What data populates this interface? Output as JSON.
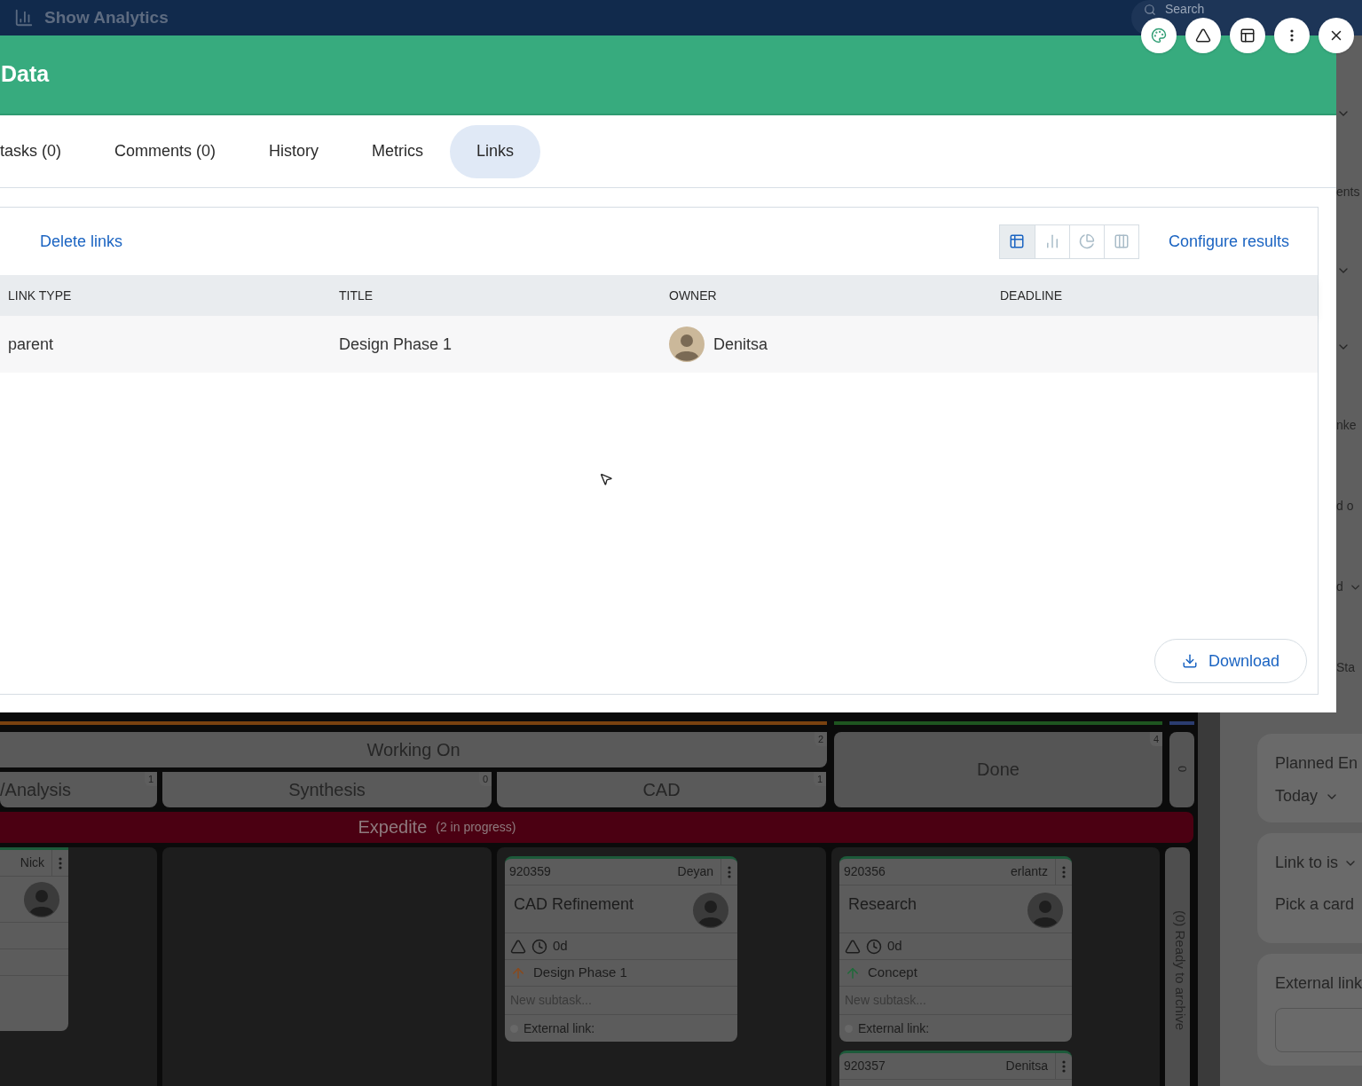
{
  "top_bar": {
    "title": "Show Analytics",
    "search": "Search"
  },
  "window_buttons": [
    {
      "kind": "palette"
    },
    {
      "kind": "warning"
    },
    {
      "kind": "layout"
    },
    {
      "kind": "more"
    },
    {
      "kind": "close"
    }
  ],
  "modal": {
    "title": "Data",
    "tabs": [
      {
        "label": "tasks (0)",
        "selected": false
      },
      {
        "label": "Comments (0)",
        "selected": false
      },
      {
        "label": "History",
        "selected": false
      },
      {
        "label": "Metrics",
        "selected": false
      },
      {
        "label": "Links",
        "selected": true
      }
    ],
    "delete_link": "Delete links",
    "views": [
      {
        "kind": "table",
        "selected": true
      },
      {
        "kind": "bar",
        "selected": false
      },
      {
        "kind": "pie",
        "selected": false
      },
      {
        "kind": "columns",
        "selected": false
      }
    ],
    "configure_link": "Configure results",
    "table": {
      "columns": [
        "LINK TYPE",
        "TITLE",
        "OWNER",
        "DEADLINE"
      ],
      "rows": [
        {
          "link_type": "parent",
          "title": "Design Phase 1",
          "owner": "Denitsa"
        }
      ]
    },
    "download_button": "Download"
  },
  "board": {
    "stages": [
      {
        "title": "Working On",
        "count": "2",
        "color": "#7a4210",
        "substages": [
          {
            "title": "/Analysis",
            "count": "1"
          },
          {
            "title": "Synthesis",
            "count": "0"
          },
          {
            "title": "CAD",
            "count": "1"
          }
        ]
      },
      {
        "title": "Done",
        "count": "4",
        "color": "#1e5520"
      }
    ],
    "archive": {
      "count": "0",
      "label": "(0) Ready to archive",
      "color": "#2b3c70"
    },
    "expedite": {
      "title": "Expedite",
      "note": "(2 in progress)"
    },
    "columns": [
      {
        "cards": [
          {
            "kind": "cut",
            "owner": "Nick"
          }
        ]
      },
      {},
      {
        "cards": [
          {
            "kind": "full",
            "id": "920359",
            "owner": "Deyan",
            "title": "CAD Refinement",
            "age": "0d",
            "link": "Design Phase 1",
            "color": "#8a4a1c",
            "subtask": "New subtask...",
            "external": "External link:"
          }
        ]
      },
      {
        "cards": [
          {
            "kind": "full",
            "id": "920356",
            "owner": "erlantz",
            "title": "Research",
            "age": "0d",
            "link": "Concept",
            "color": "#1f6a3a",
            "subtask": "New subtask...",
            "external": "External link:"
          },
          {
            "kind": "header",
            "id": "920357",
            "owner": "Denitsa"
          }
        ]
      }
    ]
  },
  "side_panel": {
    "fragments": [
      {
        "kind": "chevron"
      },
      {
        "kind": "text",
        "text": "ents"
      },
      {
        "kind": "chevron"
      },
      {
        "kind": "chevron"
      },
      {
        "kind": "text",
        "text": "nke"
      },
      {
        "kind": "text",
        "text": "d o"
      },
      {
        "kind": "text_chevron",
        "text": "d"
      },
      {
        "kind": "text",
        "text": "Sta"
      }
    ],
    "cards": [
      {
        "kind": "dropdown",
        "label": "Planned En",
        "value": "Today"
      },
      {
        "kind": "link",
        "label": "Link to is",
        "value": "Pick a card"
      },
      {
        "kind": "input",
        "label": "External link"
      }
    ]
  }
}
